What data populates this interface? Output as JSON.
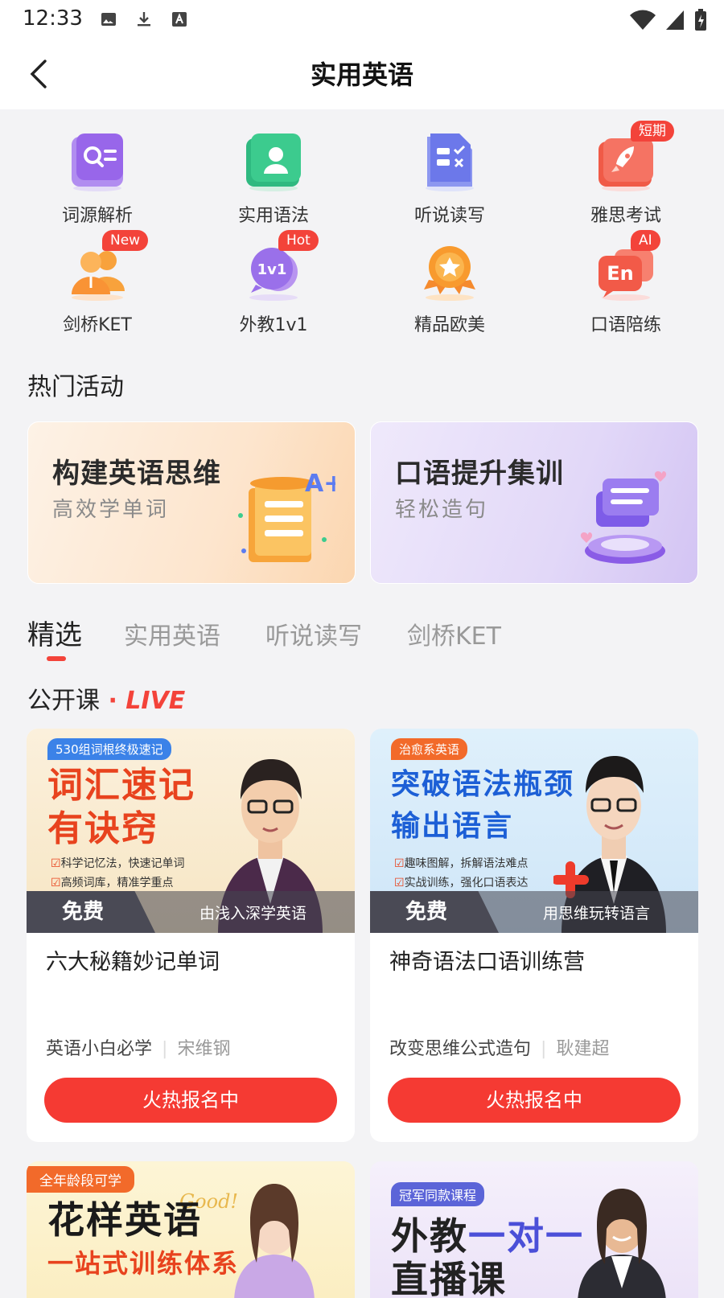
{
  "status_bar": {
    "time": "12:33"
  },
  "header": {
    "title": "实用英语"
  },
  "grid": [
    {
      "label": "词源解析",
      "badge": ""
    },
    {
      "label": "实用语法",
      "badge": ""
    },
    {
      "label": "听说读写",
      "badge": ""
    },
    {
      "label": "雅思考试",
      "badge": "短期"
    },
    {
      "label": "剑桥KET",
      "badge": "New"
    },
    {
      "label": "外教1v1",
      "badge": "Hot"
    },
    {
      "label": "精品欧美",
      "badge": ""
    },
    {
      "label": "口语陪练",
      "badge": "AI"
    }
  ],
  "hot": {
    "title": "热门活动",
    "items": [
      {
        "title": "构建英语思维",
        "subtitle": "高效学单词"
      },
      {
        "title": "口语提升集训",
        "subtitle": "轻松造句"
      }
    ]
  },
  "tabs": [
    "精选",
    "实用英语",
    "听说读写",
    "剑桥KET"
  ],
  "live": {
    "title": "公开课",
    "tag": "LIVE"
  },
  "courses": [
    {
      "img_tag": "530组词根终极速记",
      "img_line1": "词汇速记",
      "img_line2": "有诀窍",
      "bullet1": "科学记忆法，快速记单词",
      "bullet2": "高频词库，精准学重点",
      "free": "免费",
      "caption": "由浅入深学英语",
      "title": "六大秘籍妙记单词",
      "tagline": "英语小白必学",
      "teacher": "宋维钢",
      "button": "火热报名中"
    },
    {
      "img_tag": "治愈系英语",
      "img_line1": "突破语法瓶颈",
      "img_line2": "输出语言",
      "bullet1": "趣味图解，拆解语法难点",
      "bullet2": "实战训练，强化口语表达",
      "free": "免费",
      "caption": "用思维玩转语言",
      "title": "神奇语法口语训练营",
      "tagline": "改变思维公式造句",
      "teacher": "耿建超",
      "button": "火热报名中"
    }
  ],
  "more_courses": [
    {
      "img_tag": "全年龄段可学",
      "line1": "花样英语",
      "line2": "一站式训练体系",
      "script": "Good!"
    },
    {
      "img_tag": "冠军同款课程",
      "line1_a": "外教",
      "line1_b": "一对一",
      "line2": "直播课"
    }
  ],
  "colors": {
    "accent": "#f3433a",
    "button": "#f53a33"
  }
}
